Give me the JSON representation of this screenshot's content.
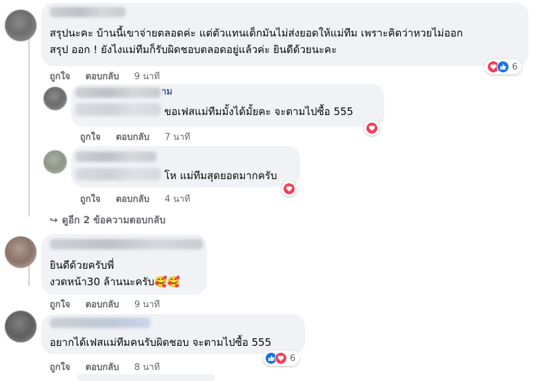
{
  "comments": [
    {
      "id": "c1",
      "name_suffix": "",
      "text_lines": [
        "สรุปนะคะ บ้านนี้เขาจ่ายตลอดค่ะ แต่ตัวแทนเด็กมันไม่ส่งยอดให้แม่ทีม เพราะคิดว่าหวยไม่ออก",
        "สรุป ออก ! ยังไงแม่ทีมก็รับผิดชอบตลอดอยู่แล้วค่ะ ยินดีด้วยนะคะ"
      ],
      "like_label": "ถูกใจ",
      "reply_label": "ตอบกลับ",
      "time": "9 นาที",
      "reactions": [
        "love",
        "like"
      ],
      "reaction_count": "6"
    },
    {
      "id": "r1",
      "name_suffix": "าม",
      "text_lines": [
        "ขอเฟสแม่ทีมมั้งได้มั้ยคะ จะตามไปซื้อ 555"
      ],
      "like_label": "ถูกใจ",
      "reply_label": "ตอบกลับ",
      "time": "7 นาที",
      "reactions": [
        "love"
      ],
      "reaction_count": ""
    },
    {
      "id": "r2",
      "name_suffix": "",
      "text_lines": [
        "โห แม่ทีมสุดยอดมากครับ"
      ],
      "like_label": "ถูกใจ",
      "reply_label": "ตอบกลับ",
      "time": "4 นาที",
      "reactions": [
        "love"
      ],
      "reaction_count": ""
    },
    {
      "id": "c2",
      "name_suffix": "",
      "text_lines": [
        "ยินดีด้วยครับพี่",
        "งวดหน้า30 ล้านนะครับ🥰🥰"
      ],
      "like_label": "ถูกใจ",
      "reply_label": "ตอบกลับ",
      "time": "9 นาที",
      "reactions": [],
      "reaction_count": ""
    },
    {
      "id": "c3",
      "name_suffix": "",
      "text_lines": [
        "อยากได้เฟสแม่ทีมคนรับผิดชอบ จะตามไปซื้อ 555"
      ],
      "like_label": "ถูกใจ",
      "reply_label": "ตอบกลับ",
      "time": "8 นาที",
      "reactions": [
        "like",
        "love"
      ],
      "reaction_count": "6"
    }
  ],
  "more_replies": "ดูอีก 2 ข้อความตอบกลับ",
  "colors": {
    "bubble": "#f0f2f5",
    "love": "#f33e58",
    "like": "#1b74e4",
    "meta": "#65676b",
    "link": "#385898"
  }
}
